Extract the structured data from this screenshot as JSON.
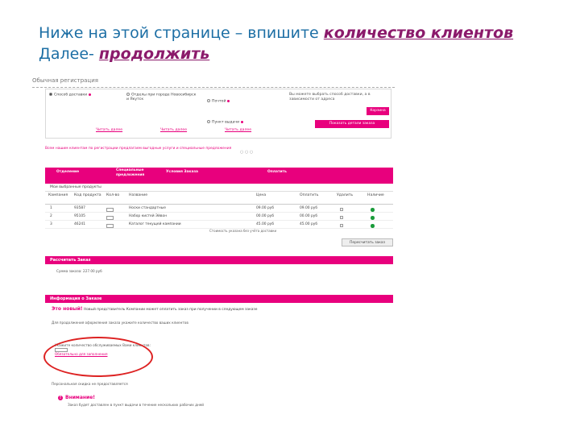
{
  "slide": {
    "line1_plain": "Ниже на этой странице – впишите ",
    "line1_em": "количество клиентов",
    "line2_plain": "Далее- ",
    "line2_em": "продолжить"
  },
  "screenshot": {
    "breadcrumb": "Обычная регистрация",
    "delivery": {
      "opt_ship": "Способ доставки",
      "opt_city": "Отделы при городе Новосибирск и Якутск",
      "opt_post": "Почтой",
      "opt_points": "Пункт выдачи",
      "hint": "Вы можете выбрать способ доставки, а в зависимости от адреса",
      "btn_cart": "Корзина",
      "btn_add": "Показать детали заказа",
      "more1": "Читать далее",
      "more2": "Читать далее",
      "more3": "Читать далее"
    },
    "note": "Всем нашим клиентам по регистрации предлагаем выгодные услуги и специальные предложения",
    "cart_header": {
      "col1": "Отделение",
      "col2": "Специальные предложения",
      "col3": "Условия Заказа",
      "col4": "Оплатить"
    },
    "cart_bar": "Мои выбранные продукты",
    "columns": [
      "Кампания",
      "Код продукта",
      "Кол-во",
      "Название",
      "Цена",
      "Оплатить",
      "Удалить",
      "Наличие"
    ],
    "rows": [
      {
        "num": "1",
        "code": "93587",
        "qty": "1",
        "name": "Носки стандартные",
        "price": "09.00 руб",
        "sum": "09.00 руб"
      },
      {
        "num": "2",
        "code": "95105",
        "qty": "1",
        "name": "Набор кистей Эйвон",
        "price": "00.00 руб",
        "sum": "00.00 руб"
      },
      {
        "num": "3",
        "code": "46241",
        "qty": "1",
        "name": "Каталог текущей кампании",
        "price": "45.00 руб",
        "sum": "45.00 руб"
      }
    ],
    "totals_note": "Стоимость указана без учёта доставки",
    "recalc": "Пересчитать заказ",
    "sec_calc": "Рассчитать Заказ",
    "summary": "Сумма заказа: 227.00 руб",
    "sec_info": "Информация о Заказе",
    "new_label": "Это новый!",
    "new_text": "Новый представитель Компании может оплатить заказ при получении в следующем заказе",
    "block1": "Для продолжения оформления заказа укажите количество ваших клиентов",
    "field_label": "Укажите количество обслуживаемых Вами клиентов:",
    "field_hint": "Обязательно для заполнения",
    "block2": "Персональная скидка не предоставляется",
    "warning": "Внимание!",
    "warn_text": "Заказ будет доставлен в пункт выдачи в течение нескольких рабочих дней"
  }
}
